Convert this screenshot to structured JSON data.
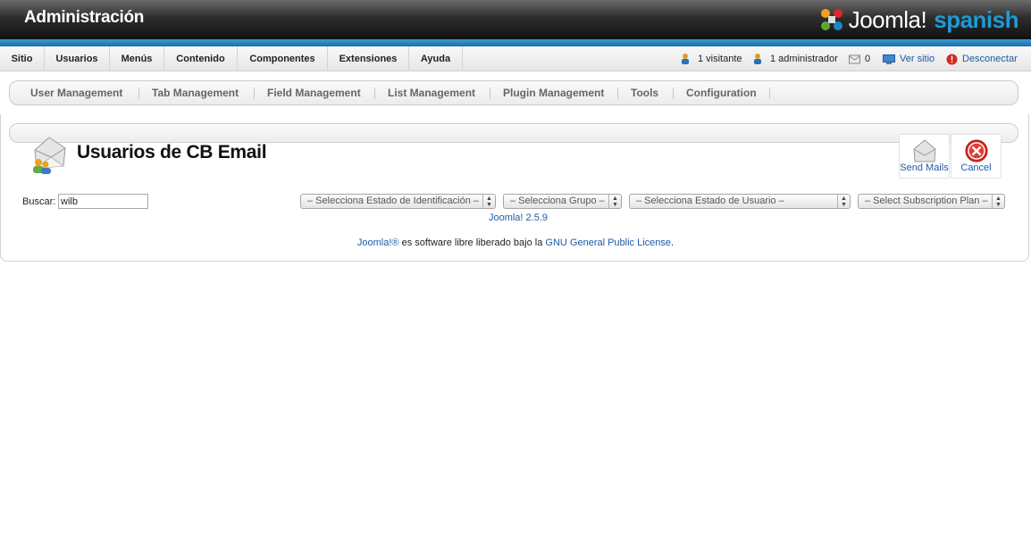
{
  "header": {
    "title": "Administración",
    "logo_text": "Joomla!",
    "logo_suffix": "spanish"
  },
  "menu": {
    "items": [
      {
        "label": "Sitio"
      },
      {
        "label": "Usuarios"
      },
      {
        "label": "Menús"
      },
      {
        "label": "Contenido"
      },
      {
        "label": "Componentes"
      },
      {
        "label": "Extensiones"
      },
      {
        "label": "Ayuda"
      }
    ]
  },
  "status": {
    "visitors": "1 visitante",
    "admins": "1 administrador",
    "messages": "0",
    "view_site": "Ver sitio",
    "logout": "Desconectar"
  },
  "submenu": {
    "items": [
      {
        "label": "User Management"
      },
      {
        "label": "Tab Management"
      },
      {
        "label": "Field Management"
      },
      {
        "label": "List Management"
      },
      {
        "label": "Plugin Management"
      },
      {
        "label": "Tools"
      },
      {
        "label": "Configuration"
      }
    ]
  },
  "page": {
    "title": "Usuarios de CB Email"
  },
  "toolbar": {
    "send_label": "Send Mails",
    "cancel_label": "Cancel"
  },
  "filters": {
    "search_label": "Buscar:",
    "search_value": "wilb",
    "login_state": "– Selecciona Estado de Identificación –",
    "group": "– Selecciona Grupo –",
    "user_state": "– Selecciona Estado de Usuario –",
    "subscription": "– Select Subscription Plan –"
  },
  "version": "Joomla! 2.5.9",
  "footer": {
    "brand": "Joomla!®",
    "middle": " es software libre liberado bajo la ",
    "license": "GNU General Public License",
    "end": "."
  },
  "colors": {
    "accent": "#1d9bd6",
    "link": "#1f5aa6",
    "header_dark": "#111111"
  }
}
